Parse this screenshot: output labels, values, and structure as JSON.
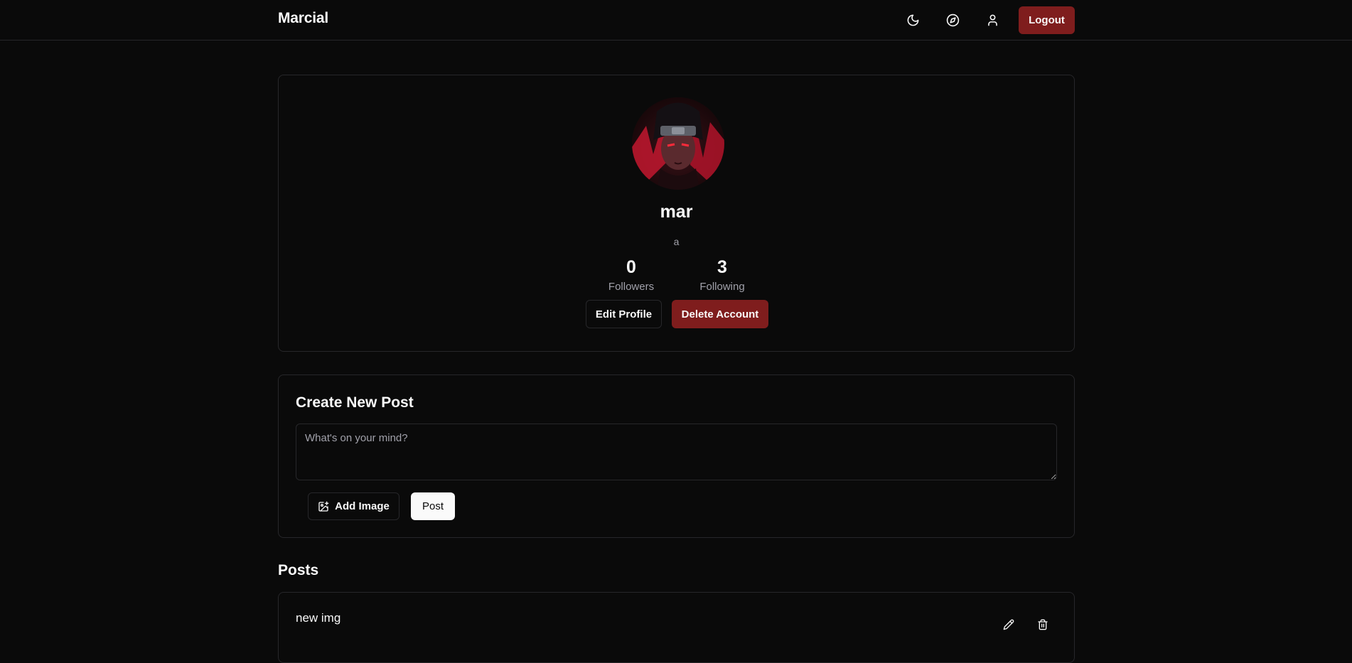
{
  "navbar": {
    "brand": "Marcial",
    "icons": [
      "moon-icon",
      "compass-icon",
      "user-icon"
    ],
    "logout_label": "Logout"
  },
  "profile": {
    "username": "mar",
    "bio": "a",
    "followers_count": "0",
    "followers_label": "Followers",
    "following_count": "3",
    "following_label": "Following",
    "edit_label": "Edit Profile",
    "delete_label": "Delete Account"
  },
  "create_post": {
    "title": "Create New Post",
    "placeholder": "What's on your mind?",
    "add_image_label": "Add Image",
    "post_label": "Post"
  },
  "posts": {
    "heading": "Posts",
    "items": [
      {
        "text": "new img"
      }
    ]
  },
  "colors": {
    "background": "#0a0a0a",
    "border": "#27272a",
    "danger": "#7f1d1d",
    "text": "#fafafa",
    "muted": "#a1a1aa"
  }
}
